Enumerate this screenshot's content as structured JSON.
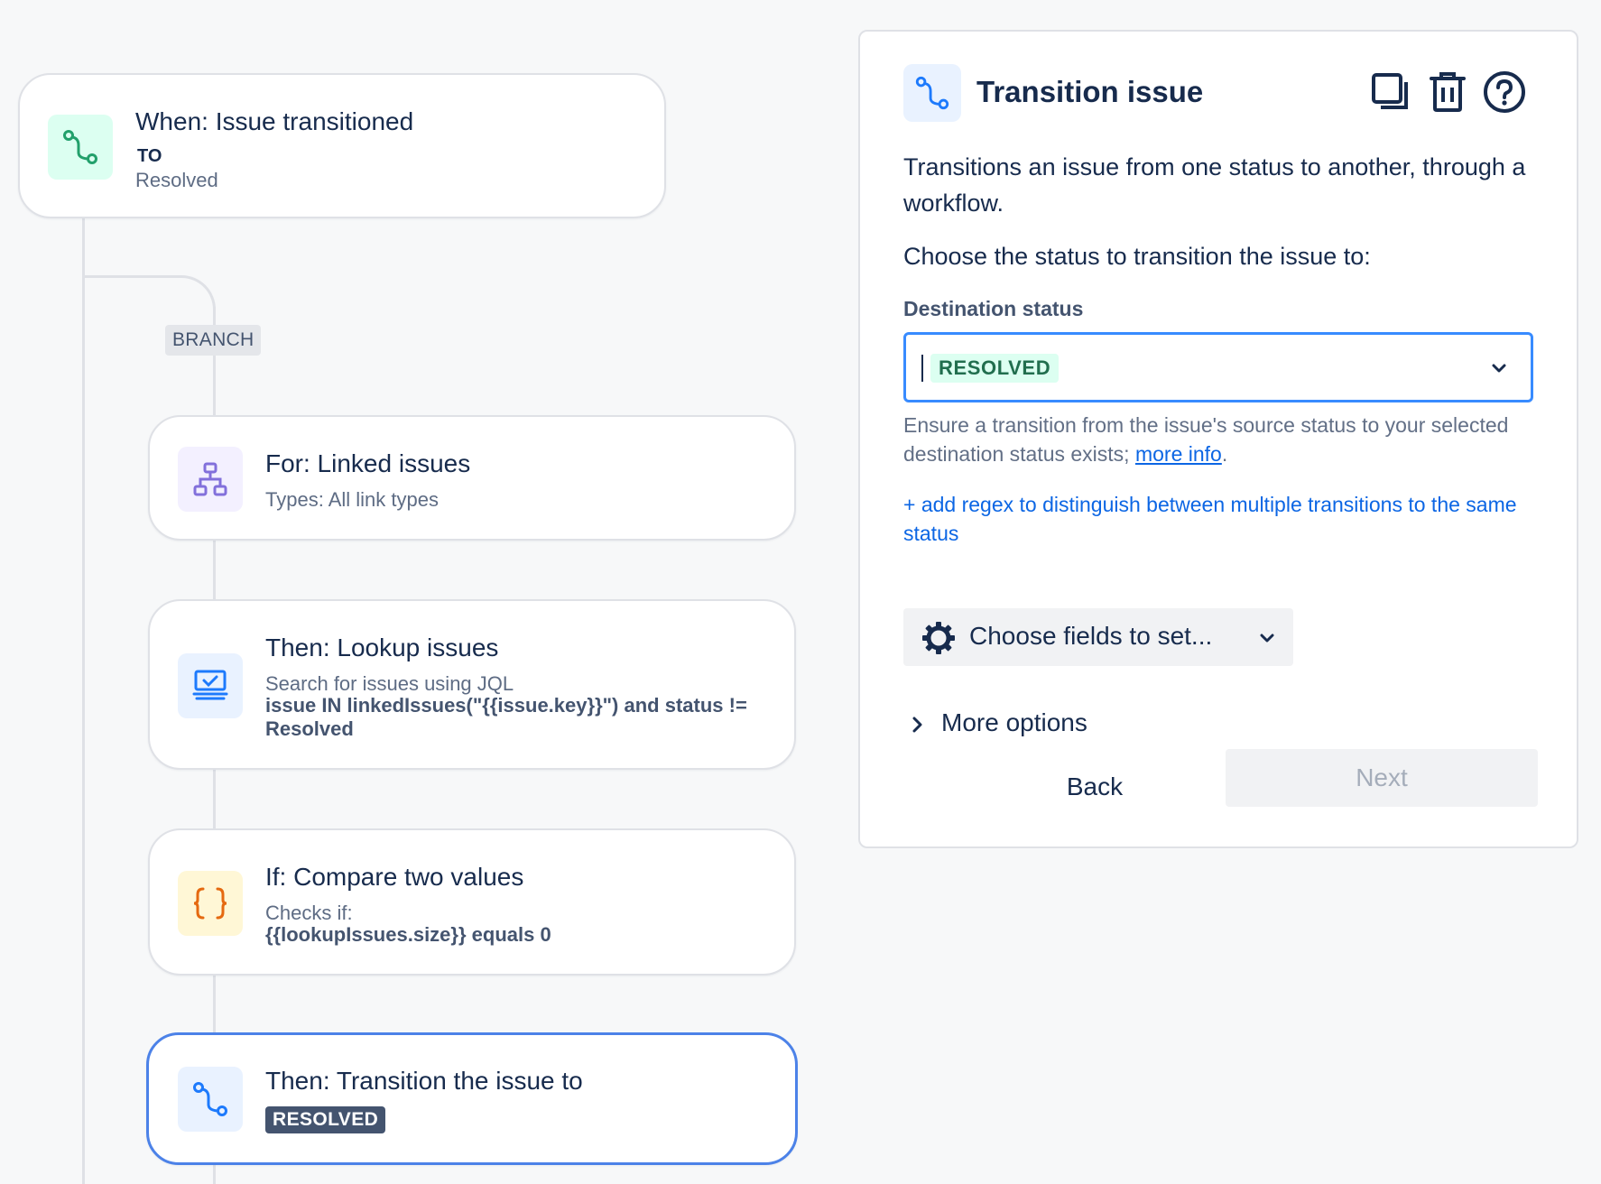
{
  "trigger": {
    "title": "When: Issue transitioned",
    "to_label": "TO",
    "status": "Resolved"
  },
  "branch_label": "BRANCH",
  "steps": [
    {
      "title": "For: Linked issues",
      "subtitle": "Types: All link types",
      "icon": "hierarchy-icon"
    },
    {
      "title": "Then: Lookup issues",
      "subtitle": "Search for issues using JQL",
      "detail": "issue IN linkedIssues(\"{{issue.key}}\") and status != Resolved",
      "icon": "lookup-icon"
    },
    {
      "title": "If: Compare two values",
      "subtitle": "Checks if:",
      "detail": "{{lookupIssues.size}} equals 0",
      "icon": "braces-icon"
    },
    {
      "title": "Then: Transition the issue to",
      "badge": "RESOLVED",
      "icon": "transition-icon"
    }
  ],
  "panel": {
    "title": "Transition issue",
    "description": "Transitions an issue from one status to another, through a workflow.",
    "choose_text": "Choose the status to transition the issue to:",
    "field_label": "Destination status",
    "selected_value": "RESOLVED",
    "help_text": "Ensure a transition from the issue's source status to your selected destination status exists;",
    "help_link": "more info",
    "help_end": ".",
    "regex_link": "+ add regex to distinguish between multiple transitions to the same status",
    "fields_button": "Choose fields to set...",
    "more_options": "More options",
    "back_button": "Back",
    "next_button": "Next"
  },
  "colors": {
    "accent_blue": "#388bff",
    "selected_border": "#4c82e8",
    "link_blue": "#0c66e4",
    "resolved_green_bg": "#dcfff1",
    "resolved_green_text": "#216e4e"
  }
}
